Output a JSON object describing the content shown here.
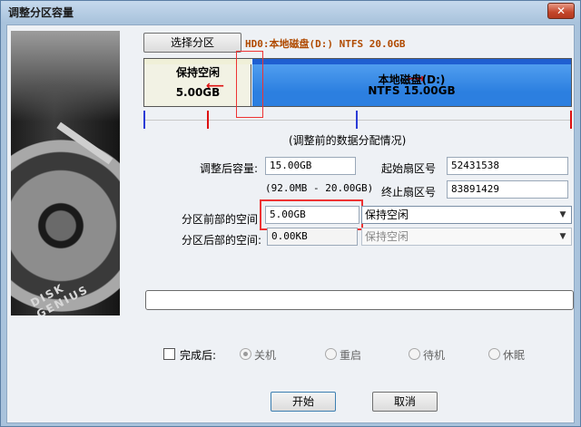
{
  "window": {
    "title": "调整分区容量",
    "close_label": "✕"
  },
  "toolbar": {
    "select_partition_label": "选择分区",
    "disk_info": "HD0:本地磁盘(D:) NTFS 20.0GB"
  },
  "partition_bar": {
    "free": {
      "label": "保持空闲",
      "size": "5.00GB"
    },
    "ntfs": {
      "label": "本地磁盘(D:)",
      "size": "NTFS 15.00GB"
    }
  },
  "caption": "(调整前的数据分配情况)",
  "fields": {
    "adjusted_size_label": "调整后容量:",
    "adjusted_size_value": "15.00GB",
    "range_note": "(92.0MB - 20.00GB)",
    "start_sector_label": "起始扇区号",
    "start_sector_value": "52431538",
    "end_sector_label": "终止扇区号",
    "end_sector_value": "83891429",
    "front_space_label": "分区前部的空间",
    "front_space_value": "5.00GB",
    "front_space_option": "保持空闲",
    "rear_space_label": "分区后部的空间:",
    "rear_space_value": "0.00KB",
    "rear_space_option": "保持空闲"
  },
  "after_completion": {
    "label": "完成后:",
    "options": [
      "关机",
      "重启",
      "待机",
      "休眠"
    ],
    "selected": "关机"
  },
  "buttons": {
    "start_label": "开始",
    "cancel_label": "取消"
  },
  "icons": {
    "arrow_left": "arrow-left-icon",
    "arrow_right": "arrow-right-icon",
    "dropdown": "chevron-down-icon",
    "close": "close-icon"
  },
  "colors": {
    "ntfs_partition": "#2c7fe0",
    "free_space": "#f2f2e4",
    "highlight": "#e33333",
    "disk_info_text": "#b04a00"
  },
  "disk_logo": "DISK GENIUS"
}
